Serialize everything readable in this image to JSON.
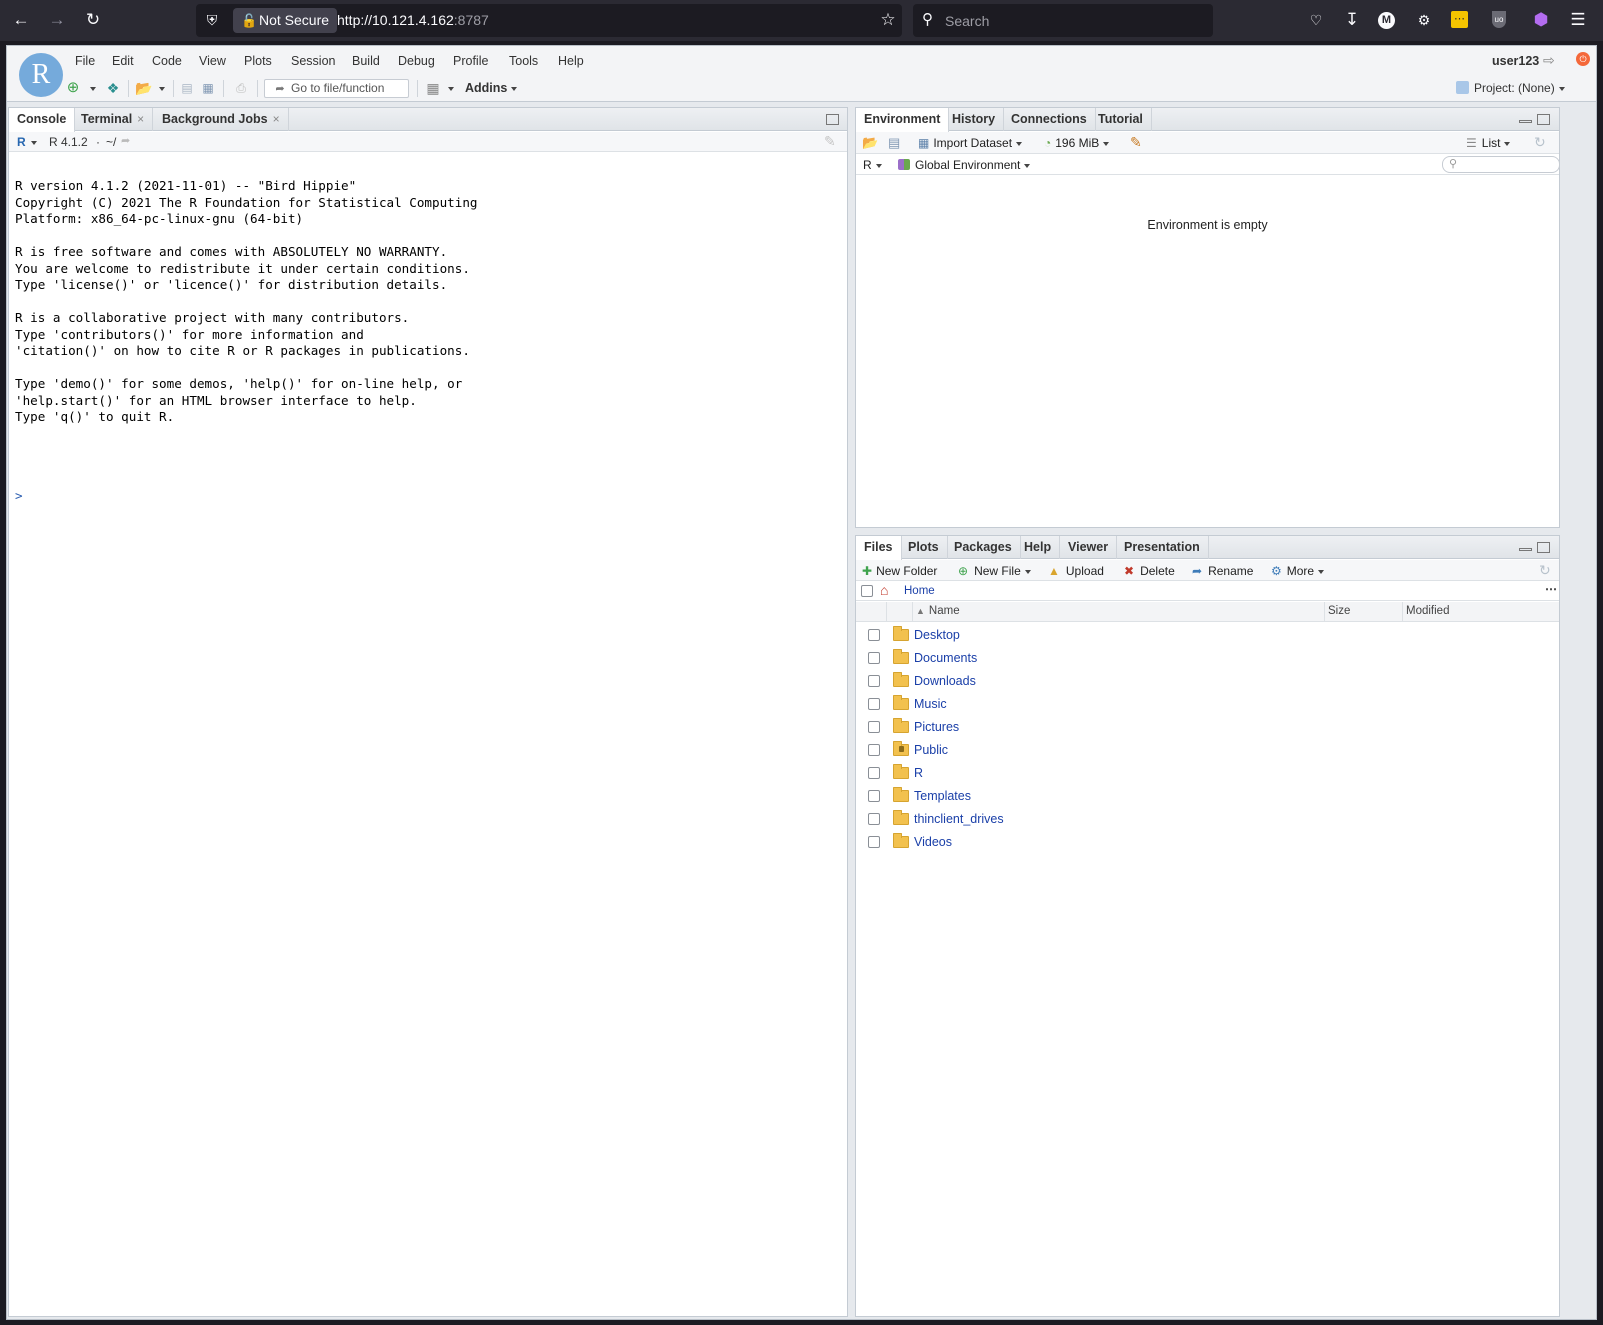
{
  "browser": {
    "security_label": "Not Secure",
    "url_host": "http://10.121.4.162",
    "url_port": ":8787",
    "search_placeholder": "Search"
  },
  "menu": [
    "File",
    "Edit",
    "Code",
    "View",
    "Plots",
    "Session",
    "Build",
    "Debug",
    "Profile",
    "Tools",
    "Help"
  ],
  "user": "user123",
  "toolbar": {
    "goto_placeholder": "Go to file/function",
    "addins_label": "Addins",
    "project_label": "Project: (None)"
  },
  "console_pane": {
    "tabs": [
      "Console",
      "Terminal",
      "Background Jobs"
    ],
    "r_version_label": "R 4.1.2",
    "path": "~/",
    "output": "R version 4.1.2 (2021-11-01) -- \"Bird Hippie\"\nCopyright (C) 2021 The R Foundation for Statistical Computing\nPlatform: x86_64-pc-linux-gnu (64-bit)\n\nR is free software and comes with ABSOLUTELY NO WARRANTY.\nYou are welcome to redistribute it under certain conditions.\nType 'license()' or 'licence()' for distribution details.\n\nR is a collaborative project with many contributors.\nType 'contributors()' for more information and\n'citation()' on how to cite R or R packages in publications.\n\nType 'demo()' for some demos, 'help()' for on-line help, or\n'help.start()' for an HTML browser interface to help.\nType 'q()' to quit R.",
    "prompt": ">"
  },
  "env_pane": {
    "tabs": [
      "Environment",
      "History",
      "Connections",
      "Tutorial"
    ],
    "import_label": "Import Dataset",
    "memory_label": "196 MiB",
    "view_mode": "List",
    "language": "R",
    "scope": "Global Environment",
    "empty_message": "Environment is empty"
  },
  "files_pane": {
    "tabs": [
      "Files",
      "Plots",
      "Packages",
      "Help",
      "Viewer",
      "Presentation"
    ],
    "actions": {
      "new_folder": "New Folder",
      "new_file": "New File",
      "upload": "Upload",
      "delete": "Delete",
      "rename": "Rename",
      "more": "More"
    },
    "breadcrumb": "Home",
    "columns": {
      "name": "Name",
      "size": "Size",
      "modified": "Modified"
    },
    "files": [
      "Desktop",
      "Documents",
      "Downloads",
      "Music",
      "Pictures",
      "Public",
      "R",
      "Templates",
      "thinclient_drives",
      "Videos"
    ]
  }
}
